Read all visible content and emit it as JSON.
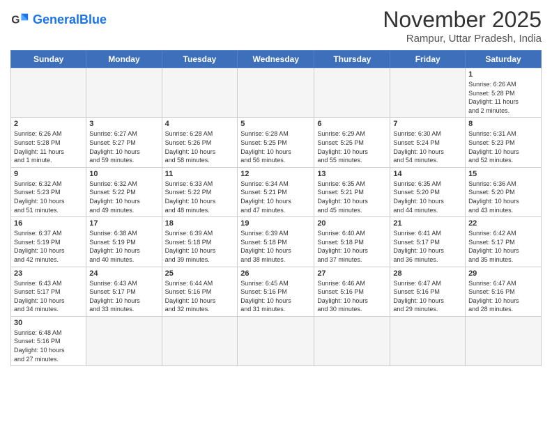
{
  "header": {
    "logo_general": "General",
    "logo_blue": "Blue",
    "month_year": "November 2025",
    "location": "Rampur, Uttar Pradesh, India"
  },
  "days_of_week": [
    "Sunday",
    "Monday",
    "Tuesday",
    "Wednesday",
    "Thursday",
    "Friday",
    "Saturday"
  ],
  "weeks": [
    [
      {
        "num": "",
        "info": ""
      },
      {
        "num": "",
        "info": ""
      },
      {
        "num": "",
        "info": ""
      },
      {
        "num": "",
        "info": ""
      },
      {
        "num": "",
        "info": ""
      },
      {
        "num": "",
        "info": ""
      },
      {
        "num": "1",
        "info": "Sunrise: 6:26 AM\nSunset: 5:28 PM\nDaylight: 11 hours\nand 2 minutes."
      }
    ],
    [
      {
        "num": "2",
        "info": "Sunrise: 6:26 AM\nSunset: 5:28 PM\nDaylight: 11 hours\nand 1 minute."
      },
      {
        "num": "3",
        "info": "Sunrise: 6:27 AM\nSunset: 5:27 PM\nDaylight: 10 hours\nand 59 minutes."
      },
      {
        "num": "4",
        "info": "Sunrise: 6:28 AM\nSunset: 5:26 PM\nDaylight: 10 hours\nand 58 minutes."
      },
      {
        "num": "5",
        "info": "Sunrise: 6:28 AM\nSunset: 5:25 PM\nDaylight: 10 hours\nand 56 minutes."
      },
      {
        "num": "6",
        "info": "Sunrise: 6:29 AM\nSunset: 5:25 PM\nDaylight: 10 hours\nand 55 minutes."
      },
      {
        "num": "7",
        "info": "Sunrise: 6:30 AM\nSunset: 5:24 PM\nDaylight: 10 hours\nand 54 minutes."
      },
      {
        "num": "8",
        "info": "Sunrise: 6:31 AM\nSunset: 5:23 PM\nDaylight: 10 hours\nand 52 minutes."
      }
    ],
    [
      {
        "num": "9",
        "info": "Sunrise: 6:32 AM\nSunset: 5:23 PM\nDaylight: 10 hours\nand 51 minutes."
      },
      {
        "num": "10",
        "info": "Sunrise: 6:32 AM\nSunset: 5:22 PM\nDaylight: 10 hours\nand 49 minutes."
      },
      {
        "num": "11",
        "info": "Sunrise: 6:33 AM\nSunset: 5:22 PM\nDaylight: 10 hours\nand 48 minutes."
      },
      {
        "num": "12",
        "info": "Sunrise: 6:34 AM\nSunset: 5:21 PM\nDaylight: 10 hours\nand 47 minutes."
      },
      {
        "num": "13",
        "info": "Sunrise: 6:35 AM\nSunset: 5:21 PM\nDaylight: 10 hours\nand 45 minutes."
      },
      {
        "num": "14",
        "info": "Sunrise: 6:35 AM\nSunset: 5:20 PM\nDaylight: 10 hours\nand 44 minutes."
      },
      {
        "num": "15",
        "info": "Sunrise: 6:36 AM\nSunset: 5:20 PM\nDaylight: 10 hours\nand 43 minutes."
      }
    ],
    [
      {
        "num": "16",
        "info": "Sunrise: 6:37 AM\nSunset: 5:19 PM\nDaylight: 10 hours\nand 42 minutes."
      },
      {
        "num": "17",
        "info": "Sunrise: 6:38 AM\nSunset: 5:19 PM\nDaylight: 10 hours\nand 40 minutes."
      },
      {
        "num": "18",
        "info": "Sunrise: 6:39 AM\nSunset: 5:18 PM\nDaylight: 10 hours\nand 39 minutes."
      },
      {
        "num": "19",
        "info": "Sunrise: 6:39 AM\nSunset: 5:18 PM\nDaylight: 10 hours\nand 38 minutes."
      },
      {
        "num": "20",
        "info": "Sunrise: 6:40 AM\nSunset: 5:18 PM\nDaylight: 10 hours\nand 37 minutes."
      },
      {
        "num": "21",
        "info": "Sunrise: 6:41 AM\nSunset: 5:17 PM\nDaylight: 10 hours\nand 36 minutes."
      },
      {
        "num": "22",
        "info": "Sunrise: 6:42 AM\nSunset: 5:17 PM\nDaylight: 10 hours\nand 35 minutes."
      }
    ],
    [
      {
        "num": "23",
        "info": "Sunrise: 6:43 AM\nSunset: 5:17 PM\nDaylight: 10 hours\nand 34 minutes."
      },
      {
        "num": "24",
        "info": "Sunrise: 6:43 AM\nSunset: 5:17 PM\nDaylight: 10 hours\nand 33 minutes."
      },
      {
        "num": "25",
        "info": "Sunrise: 6:44 AM\nSunset: 5:16 PM\nDaylight: 10 hours\nand 32 minutes."
      },
      {
        "num": "26",
        "info": "Sunrise: 6:45 AM\nSunset: 5:16 PM\nDaylight: 10 hours\nand 31 minutes."
      },
      {
        "num": "27",
        "info": "Sunrise: 6:46 AM\nSunset: 5:16 PM\nDaylight: 10 hours\nand 30 minutes."
      },
      {
        "num": "28",
        "info": "Sunrise: 6:47 AM\nSunset: 5:16 PM\nDaylight: 10 hours\nand 29 minutes."
      },
      {
        "num": "29",
        "info": "Sunrise: 6:47 AM\nSunset: 5:16 PM\nDaylight: 10 hours\nand 28 minutes."
      }
    ],
    [
      {
        "num": "30",
        "info": "Sunrise: 6:48 AM\nSunset: 5:16 PM\nDaylight: 10 hours\nand 27 minutes."
      },
      {
        "num": "",
        "info": ""
      },
      {
        "num": "",
        "info": ""
      },
      {
        "num": "",
        "info": ""
      },
      {
        "num": "",
        "info": ""
      },
      {
        "num": "",
        "info": ""
      },
      {
        "num": "",
        "info": ""
      }
    ]
  ]
}
